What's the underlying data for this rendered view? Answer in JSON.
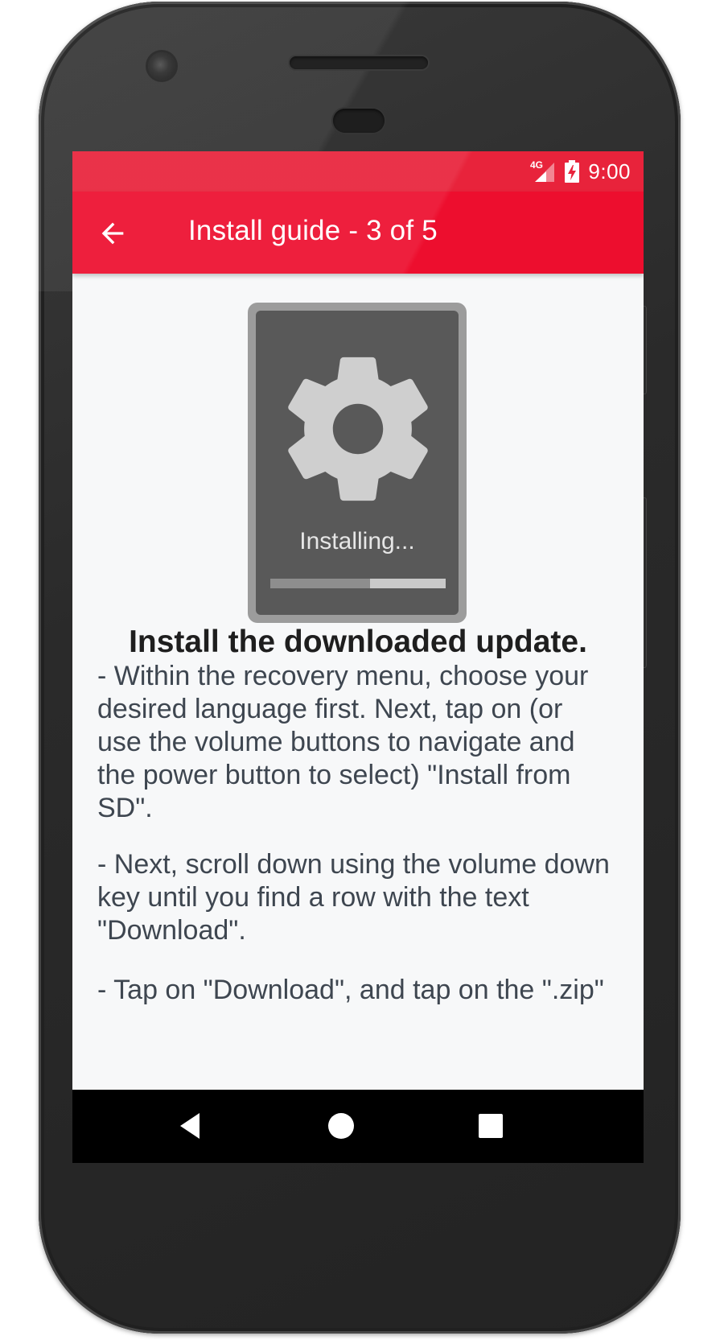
{
  "status_bar": {
    "network": "4G",
    "time": "9:00",
    "battery_icon": "battery-charging-icon",
    "signal_icon": "signal-icon"
  },
  "app_bar": {
    "title": "Install guide - 3 of 5",
    "back_icon": "arrow-back-icon",
    "color": "#ed0e2e"
  },
  "illustration": {
    "icon": "gear-icon",
    "label": "Installing...",
    "progress": 0.57
  },
  "content": {
    "heading": "Install the downloaded update.",
    "paragraphs": [
      "- Within the recovery menu, choose your desired language first. Next, tap on (or use the volume buttons to navigate and the power button to select) \"Install from SD\".",
      "- Next, scroll down using the volume down key until you find a row with the text \"Download\".",
      "- Tap on \"Download\", and tap on the \".zip\""
    ]
  },
  "nav_bar": {
    "back_icon": "nav-back-icon",
    "home_icon": "nav-home-icon",
    "recents_icon": "nav-recents-icon"
  }
}
